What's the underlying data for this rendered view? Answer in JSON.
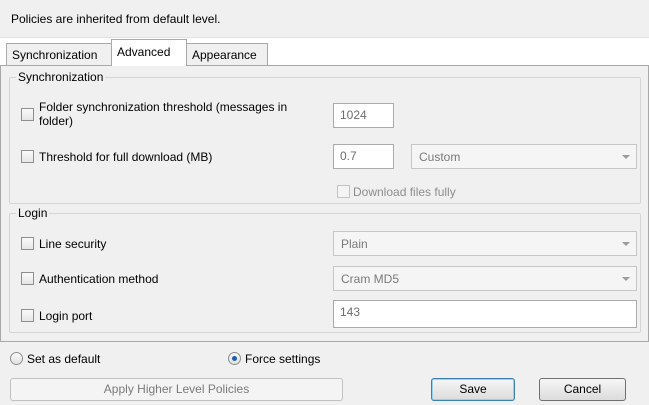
{
  "notice": {
    "text": "Policies are inherited from default level."
  },
  "tabs": [
    {
      "label": "Synchronization"
    },
    {
      "label": "Advanced"
    },
    {
      "label": "Appearance"
    }
  ],
  "synchronization": {
    "title": "Synchronization",
    "folder_threshold": {
      "label": "Folder synchronization threshold (messages in folder)",
      "value": "1024"
    },
    "full_download": {
      "label": "Threshold for full download (MB)",
      "value": "0.7",
      "unit": "Custom"
    },
    "download_files_fully": {
      "label": "Download files fully"
    }
  },
  "login": {
    "title": "Login",
    "line_security": {
      "label": "Line security",
      "value": "Plain"
    },
    "auth_method": {
      "label": "Authentication method",
      "value": "Cram MD5"
    },
    "login_port": {
      "label": "Login port",
      "value": "143"
    }
  },
  "footer": {
    "set_as_default": "Set as default",
    "force_settings": "Force settings",
    "apply_higher": "Apply Higher Level Policies",
    "save": "Save",
    "cancel": "Cancel"
  }
}
